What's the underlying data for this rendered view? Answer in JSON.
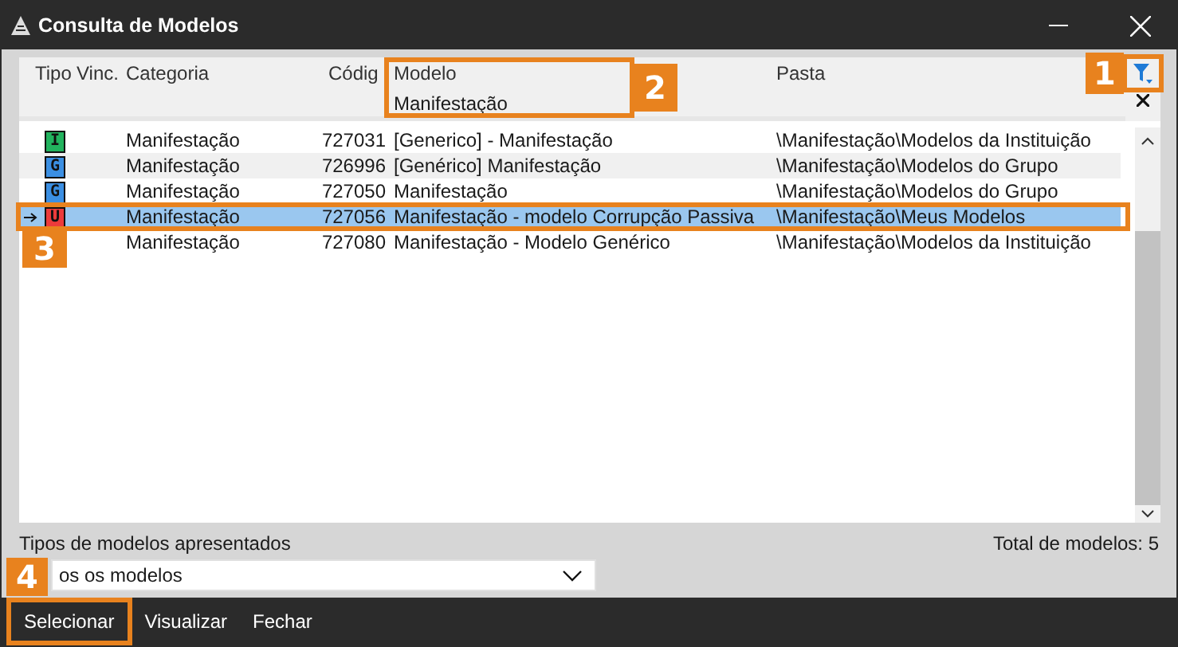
{
  "window": {
    "title": "Consulta de Modelos"
  },
  "table": {
    "columns": [
      "Tipo",
      "Vinc.",
      "Categoria",
      "Códig",
      "Modelo",
      "Pasta"
    ],
    "filter": {
      "value": "Manifestação"
    },
    "rows": [
      {
        "tipo": "I",
        "color": "#22b35e",
        "categoria": "Manifestação",
        "codigo": "727031",
        "modelo": "[Generico] - Manifestação",
        "pasta": "\\Manifestação\\Modelos da Instituição",
        "selected": false,
        "current": false
      },
      {
        "tipo": "G",
        "color": "#3b8fe3",
        "categoria": "Manifestação",
        "codigo": "726996",
        "modelo": "[Genérico] Manifestação",
        "pasta": "\\Manifestação\\Modelos do Grupo",
        "selected": false,
        "current": false
      },
      {
        "tipo": "G",
        "color": "#3b8fe3",
        "categoria": "Manifestação",
        "codigo": "727050",
        "modelo": "Manifestação",
        "pasta": "\\Manifestação\\Modelos do Grupo",
        "selected": false,
        "current": false
      },
      {
        "tipo": "U",
        "color": "#ec3b3b",
        "categoria": "Manifestação",
        "codigo": "727056",
        "modelo": "Manifestação - modelo Corrupção Passiva",
        "pasta": "\\Manifestação\\Meus Modelos",
        "selected": true,
        "current": true
      },
      {
        "categoria": "Manifestação",
        "codigo": "727080",
        "modelo": "Manifestação - Modelo Genérico",
        "pasta": "\\Manifestação\\Modelos da Instituição",
        "selected": false,
        "current": false
      }
    ]
  },
  "types_label": "Tipos de modelos apresentados",
  "types_dropdown": {
    "value": "os os modelos"
  },
  "total": "Total de modelos: 5",
  "buttons": [
    "Selecionar",
    "Visualizar",
    "Fechar"
  ],
  "callouts": [
    "1",
    "2",
    "3",
    "4"
  ]
}
